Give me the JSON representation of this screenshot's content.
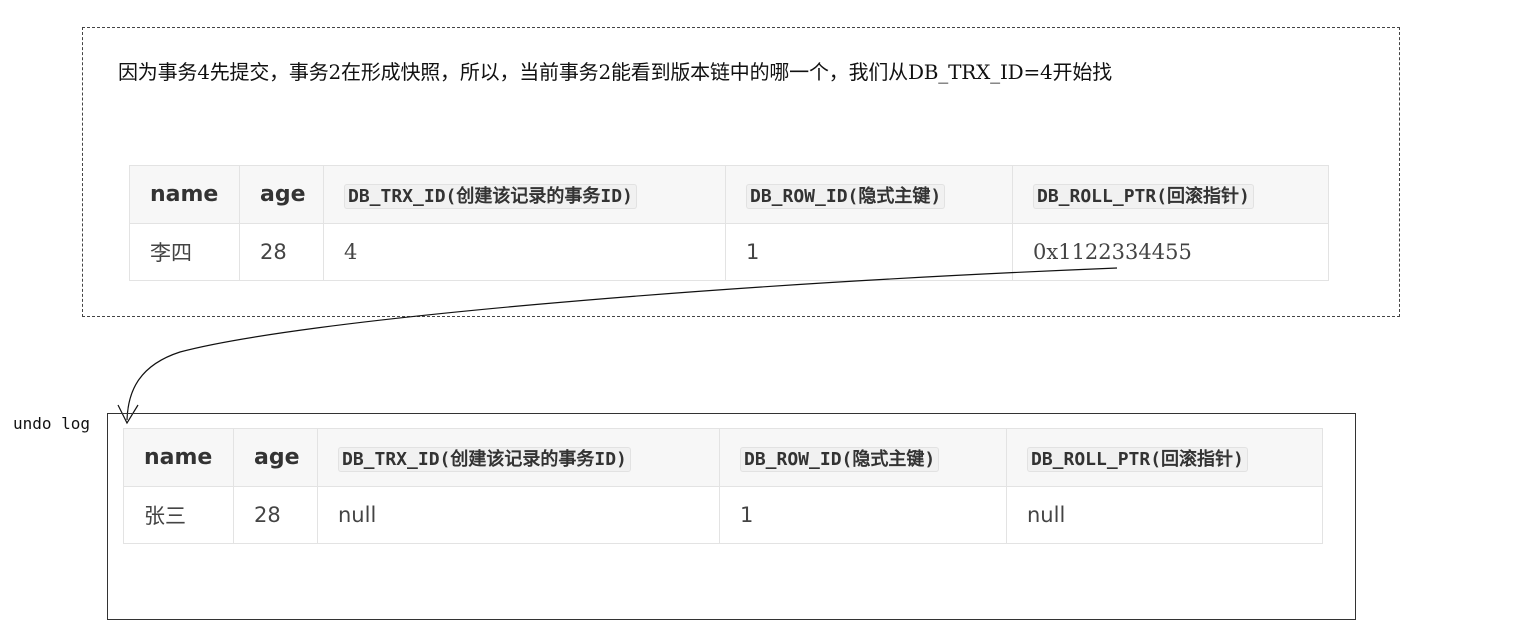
{
  "note": "因为事务4先提交，事务2在形成快照，所以，当前事务2能看到版本链中的哪一个，我们从DB_TRX_ID=4开始找",
  "undo_label": "undo log",
  "headers": {
    "name": "name",
    "age": "age",
    "trx_id": "DB_TRX_ID(创建该记录的事务ID)",
    "row_id": "DB_ROW_ID(隐式主键)",
    "roll_ptr": "DB_ROLL_PTR(回滚指针)"
  },
  "current_record": {
    "name": "李四",
    "age": "28",
    "trx_id": "4",
    "row_id": "1",
    "roll_ptr": "0x1122334455"
  },
  "undo_record": {
    "name": "张三",
    "age": "28",
    "trx_id": "null",
    "row_id": "1",
    "roll_ptr": "null"
  }
}
